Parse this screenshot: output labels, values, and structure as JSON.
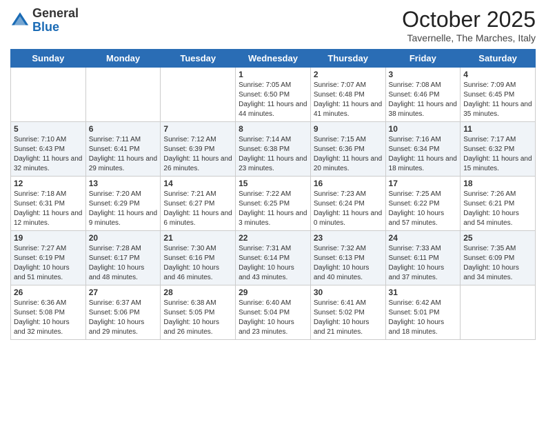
{
  "header": {
    "logo_line1": "General",
    "logo_line2": "Blue",
    "month": "October 2025",
    "location": "Tavernelle, The Marches, Italy"
  },
  "days_of_week": [
    "Sunday",
    "Monday",
    "Tuesday",
    "Wednesday",
    "Thursday",
    "Friday",
    "Saturday"
  ],
  "weeks": [
    [
      {
        "day": "",
        "info": ""
      },
      {
        "day": "",
        "info": ""
      },
      {
        "day": "",
        "info": ""
      },
      {
        "day": "1",
        "info": "Sunrise: 7:05 AM\nSunset: 6:50 PM\nDaylight: 11 hours and 44 minutes."
      },
      {
        "day": "2",
        "info": "Sunrise: 7:07 AM\nSunset: 6:48 PM\nDaylight: 11 hours and 41 minutes."
      },
      {
        "day": "3",
        "info": "Sunrise: 7:08 AM\nSunset: 6:46 PM\nDaylight: 11 hours and 38 minutes."
      },
      {
        "day": "4",
        "info": "Sunrise: 7:09 AM\nSunset: 6:45 PM\nDaylight: 11 hours and 35 minutes."
      }
    ],
    [
      {
        "day": "5",
        "info": "Sunrise: 7:10 AM\nSunset: 6:43 PM\nDaylight: 11 hours and 32 minutes."
      },
      {
        "day": "6",
        "info": "Sunrise: 7:11 AM\nSunset: 6:41 PM\nDaylight: 11 hours and 29 minutes."
      },
      {
        "day": "7",
        "info": "Sunrise: 7:12 AM\nSunset: 6:39 PM\nDaylight: 11 hours and 26 minutes."
      },
      {
        "day": "8",
        "info": "Sunrise: 7:14 AM\nSunset: 6:38 PM\nDaylight: 11 hours and 23 minutes."
      },
      {
        "day": "9",
        "info": "Sunrise: 7:15 AM\nSunset: 6:36 PM\nDaylight: 11 hours and 20 minutes."
      },
      {
        "day": "10",
        "info": "Sunrise: 7:16 AM\nSunset: 6:34 PM\nDaylight: 11 hours and 18 minutes."
      },
      {
        "day": "11",
        "info": "Sunrise: 7:17 AM\nSunset: 6:32 PM\nDaylight: 11 hours and 15 minutes."
      }
    ],
    [
      {
        "day": "12",
        "info": "Sunrise: 7:18 AM\nSunset: 6:31 PM\nDaylight: 11 hours and 12 minutes."
      },
      {
        "day": "13",
        "info": "Sunrise: 7:20 AM\nSunset: 6:29 PM\nDaylight: 11 hours and 9 minutes."
      },
      {
        "day": "14",
        "info": "Sunrise: 7:21 AM\nSunset: 6:27 PM\nDaylight: 11 hours and 6 minutes."
      },
      {
        "day": "15",
        "info": "Sunrise: 7:22 AM\nSunset: 6:25 PM\nDaylight: 11 hours and 3 minutes."
      },
      {
        "day": "16",
        "info": "Sunrise: 7:23 AM\nSunset: 6:24 PM\nDaylight: 11 hours and 0 minutes."
      },
      {
        "day": "17",
        "info": "Sunrise: 7:25 AM\nSunset: 6:22 PM\nDaylight: 10 hours and 57 minutes."
      },
      {
        "day": "18",
        "info": "Sunrise: 7:26 AM\nSunset: 6:21 PM\nDaylight: 10 hours and 54 minutes."
      }
    ],
    [
      {
        "day": "19",
        "info": "Sunrise: 7:27 AM\nSunset: 6:19 PM\nDaylight: 10 hours and 51 minutes."
      },
      {
        "day": "20",
        "info": "Sunrise: 7:28 AM\nSunset: 6:17 PM\nDaylight: 10 hours and 48 minutes."
      },
      {
        "day": "21",
        "info": "Sunrise: 7:30 AM\nSunset: 6:16 PM\nDaylight: 10 hours and 46 minutes."
      },
      {
        "day": "22",
        "info": "Sunrise: 7:31 AM\nSunset: 6:14 PM\nDaylight: 10 hours and 43 minutes."
      },
      {
        "day": "23",
        "info": "Sunrise: 7:32 AM\nSunset: 6:13 PM\nDaylight: 10 hours and 40 minutes."
      },
      {
        "day": "24",
        "info": "Sunrise: 7:33 AM\nSunset: 6:11 PM\nDaylight: 10 hours and 37 minutes."
      },
      {
        "day": "25",
        "info": "Sunrise: 7:35 AM\nSunset: 6:09 PM\nDaylight: 10 hours and 34 minutes."
      }
    ],
    [
      {
        "day": "26",
        "info": "Sunrise: 6:36 AM\nSunset: 5:08 PM\nDaylight: 10 hours and 32 minutes."
      },
      {
        "day": "27",
        "info": "Sunrise: 6:37 AM\nSunset: 5:06 PM\nDaylight: 10 hours and 29 minutes."
      },
      {
        "day": "28",
        "info": "Sunrise: 6:38 AM\nSunset: 5:05 PM\nDaylight: 10 hours and 26 minutes."
      },
      {
        "day": "29",
        "info": "Sunrise: 6:40 AM\nSunset: 5:04 PM\nDaylight: 10 hours and 23 minutes."
      },
      {
        "day": "30",
        "info": "Sunrise: 6:41 AM\nSunset: 5:02 PM\nDaylight: 10 hours and 21 minutes."
      },
      {
        "day": "31",
        "info": "Sunrise: 6:42 AM\nSunset: 5:01 PM\nDaylight: 10 hours and 18 minutes."
      },
      {
        "day": "",
        "info": ""
      }
    ]
  ]
}
